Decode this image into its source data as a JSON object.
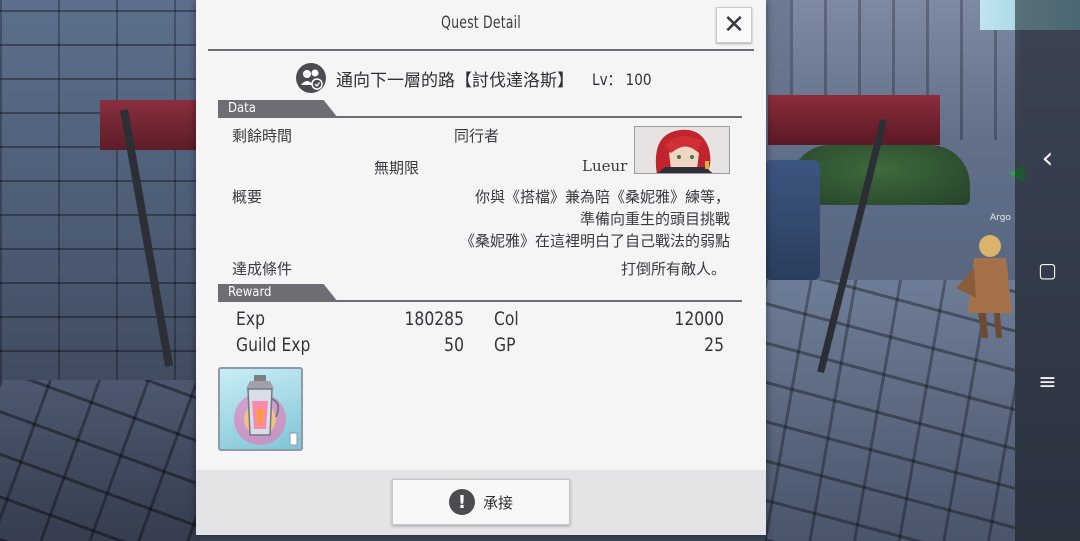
{
  "dialog": {
    "title": "Quest Detail",
    "close_symbol": "✕"
  },
  "quest": {
    "icon": "party-icon",
    "name": "通向下一層的路【討伐達洛斯】",
    "level_label": "Lv： 100"
  },
  "data_section": {
    "tab_label": "Data",
    "time_label": "剩餘時間",
    "time_value": "無期限",
    "companion_label": "同行者",
    "companion_name": "Lueur",
    "summary_label": "概要",
    "summary_lines": [
      "你與《搭檔》兼為陪《桑妮雅》練等，",
      "準備向重生的頭目挑戰",
      "《桑妮雅》在這裡明白了自己戰法的弱點"
    ],
    "condition_label": "達成條件",
    "condition_value": "打倒所有敵人。"
  },
  "reward_section": {
    "tab_label": "Reward",
    "exp_label": "Exp",
    "exp_value": "180285",
    "col_label": "Col",
    "col_value": "12000",
    "guild_exp_label": "Guild Exp",
    "guild_exp_value": "50",
    "gp_label": "GP",
    "gp_value": "25",
    "item_icon": "lantern-potion-icon"
  },
  "footer": {
    "accept_label": "承接",
    "accept_icon": "exclamation-icon"
  },
  "scene": {
    "npc_name": "Argo"
  },
  "navbar": {
    "back_symbol": "‹",
    "home_symbol": "▢",
    "menu_symbol": "≡"
  },
  "colors": {
    "panel": "#f5f5f6",
    "tab": "#6d6d73",
    "text": "#34343a"
  }
}
